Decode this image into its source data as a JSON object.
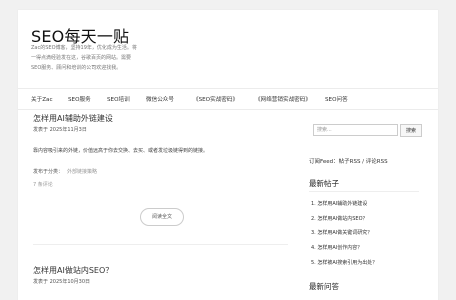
{
  "site": {
    "title": "SEO每天一贴",
    "desc_lines": [
      "Zac的SEO博客，坚持19年，优化成为生活。将",
      "一得点滴经验发在这，谷歌百页的网站。需要",
      "SEO服务、顾问和培训的公司欢迎找我。"
    ]
  },
  "nav": {
    "items": [
      "关于Zac",
      "SEO服务",
      "SEO培训",
      "微信公众号",
      "《SEO实战密码》",
      "《网络营销实战密码》",
      "SEO问答"
    ]
  },
  "posts": [
    {
      "title": "怎样用AI辅助外链建设",
      "date": "发表于 2025年11月3日",
      "excerpt": "靠内容吸引来的外链，价值远高于你去交换、去买、或者发垃圾链得到的链接。",
      "category_label": "发布于分类：",
      "category": "外部链接策略",
      "comments": "7 条评论",
      "read_more": "阅读全文"
    },
    {
      "title": "怎样用AI做站内SEO？",
      "date": "发表于 2025年10月30日"
    }
  ],
  "sidebar": {
    "search_placeholder": "搜索...",
    "search_button": "搜索",
    "rss_prefix": "订阅Feed：",
    "rss_posts": "帖子RSS",
    "rss_sep": " / ",
    "rss_comments": "评论RSS",
    "recent_title": "最新帖子",
    "recent_posts": [
      "1. 怎样用AI辅助外链建设",
      "2. 怎样用AI做站内SEO？",
      "3. 怎样用AI做关键词研究？",
      "4. 怎样用AI创作内容？",
      "5. 怎样被AI搜索引用为出处？"
    ],
    "qa_title": "最新问答"
  }
}
